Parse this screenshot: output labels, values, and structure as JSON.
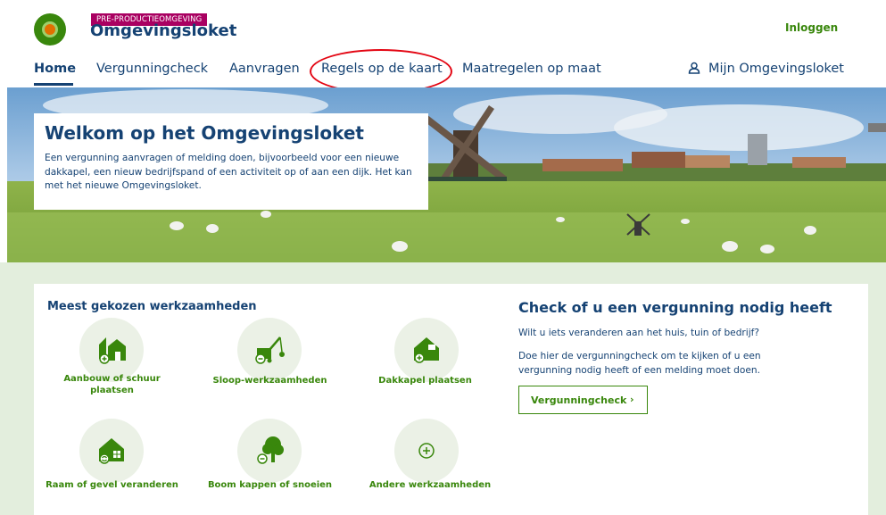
{
  "header": {
    "badge": "PRE-PRODUCTIEOMGEVING",
    "logo_text": "Omgevingsloket",
    "login": "Inloggen"
  },
  "nav": {
    "items": [
      "Home",
      "Vergunningcheck",
      "Aanvragen",
      "Regels op de kaart",
      "Maatregelen op maat"
    ],
    "account": "Mijn Omgevingsloket",
    "active": "Home"
  },
  "hero": {
    "title": "Welkom op het Omgevingsloket",
    "text": "Een vergunning aanvragen of melding doen, bijvoorbeeld voor een nieuwe dakkapel, een nieuw bedrijfspand of een activiteit op of aan een dijk. Het kan met het nieuwe Omgevingsloket."
  },
  "popular": {
    "heading": "Meest gekozen werkzaamheden",
    "tiles": [
      {
        "label": "Aanbouw of schuur plaatsen",
        "icon": "extension-house-icon"
      },
      {
        "label": "Sloop-werkzaamheden",
        "icon": "demolition-crane-icon"
      },
      {
        "label": "Dakkapel plaatsen",
        "icon": "dormer-house-icon"
      },
      {
        "label": "Raam of gevel veranderen",
        "icon": "window-house-icon"
      },
      {
        "label": "Boom kappen of snoeien",
        "icon": "tree-icon"
      },
      {
        "label": "Andere werkzaamheden",
        "icon": "plus-circle-icon"
      }
    ]
  },
  "check": {
    "title": "Check of u een vergunning nodig heeft",
    "question": "Wilt u iets veranderen aan het huis, tuin of bedrijf?",
    "text": "Doe hier de vergunningcheck om te kijken of u een vergunning nodig heeft of een melding moet doen.",
    "button": "Vergunningcheck"
  },
  "colors": {
    "primary": "#154273",
    "green": "#39870c",
    "badge": "#a90061",
    "section_bg": "#e3eedd",
    "annotation": "#e30613"
  }
}
